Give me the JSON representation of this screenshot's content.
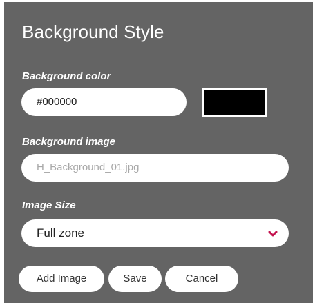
{
  "panel": {
    "title": "Background Style"
  },
  "background_color": {
    "label": "Background color",
    "value": "#000000",
    "swatch_color": "#000000"
  },
  "background_image": {
    "label": "Background image",
    "placeholder": "H_Background_01.jpg"
  },
  "image_size": {
    "label": "Image Size",
    "selected": "Full zone",
    "chevron_icon": "chevron-down-icon",
    "accent_color": "#c4124e"
  },
  "buttons": {
    "add_image": "Add Image",
    "save": "Save",
    "cancel": "Cancel"
  }
}
